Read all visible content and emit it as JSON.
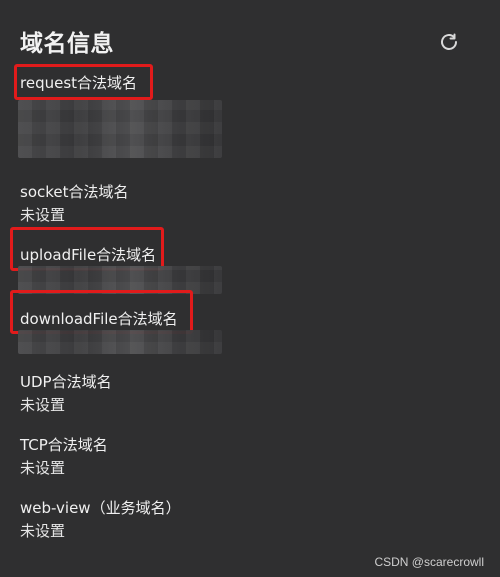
{
  "panel": {
    "title": "域名信息",
    "refresh_icon": "refresh-icon"
  },
  "sections": [
    {
      "label": "request合法域名",
      "value": ""
    },
    {
      "label": "socket合法域名",
      "value": "未设置"
    },
    {
      "label": "uploadFile合法域名",
      "value": ""
    },
    {
      "label": "downloadFile合法域名",
      "value": ""
    },
    {
      "label": "UDP合法域名",
      "value": "未设置"
    },
    {
      "label": "TCP合法域名",
      "value": "未设置"
    },
    {
      "label": "web-view（业务域名）",
      "value": "未设置"
    }
  ],
  "watermark": "CSDN @scarecrowll",
  "colors": {
    "background": "#2f2f30",
    "text": "#e8e8e8",
    "highlight": "#e11b1b"
  }
}
